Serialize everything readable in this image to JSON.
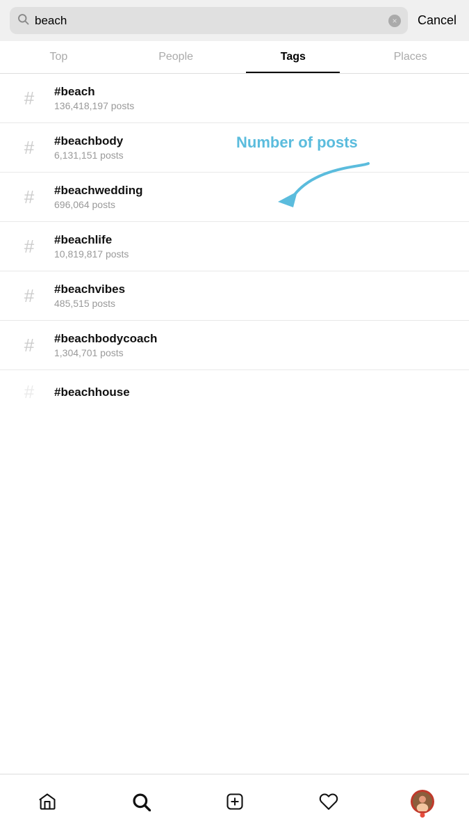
{
  "search": {
    "value": "beach",
    "placeholder": "Search",
    "clear_label": "×",
    "cancel_label": "Cancel"
  },
  "tabs": [
    {
      "id": "top",
      "label": "Top",
      "active": false
    },
    {
      "id": "people",
      "label": "People",
      "active": false
    },
    {
      "id": "tags",
      "label": "Tags",
      "active": true
    },
    {
      "id": "places",
      "label": "Places",
      "active": false
    }
  ],
  "annotation": {
    "text": "Number of posts"
  },
  "tags": [
    {
      "name": "#beach",
      "posts": "136,418,197 posts"
    },
    {
      "name": "#beachbody",
      "posts": "6,131,151 posts"
    },
    {
      "name": "#beachwedding",
      "posts": "696,064 posts"
    },
    {
      "name": "#beachlife",
      "posts": "10,819,817 posts"
    },
    {
      "name": "#beachvibes",
      "posts": "485,515 posts"
    },
    {
      "name": "#beachbodycoach",
      "posts": "1,304,701 posts"
    },
    {
      "name": "#beachhouse",
      "posts": ""
    }
  ],
  "nav": {
    "home_label": "Home",
    "search_label": "Search",
    "add_label": "Add",
    "heart_label": "Activity",
    "profile_label": "Profile"
  },
  "icons": {
    "hash": "#",
    "search": "search",
    "clear": "×"
  }
}
